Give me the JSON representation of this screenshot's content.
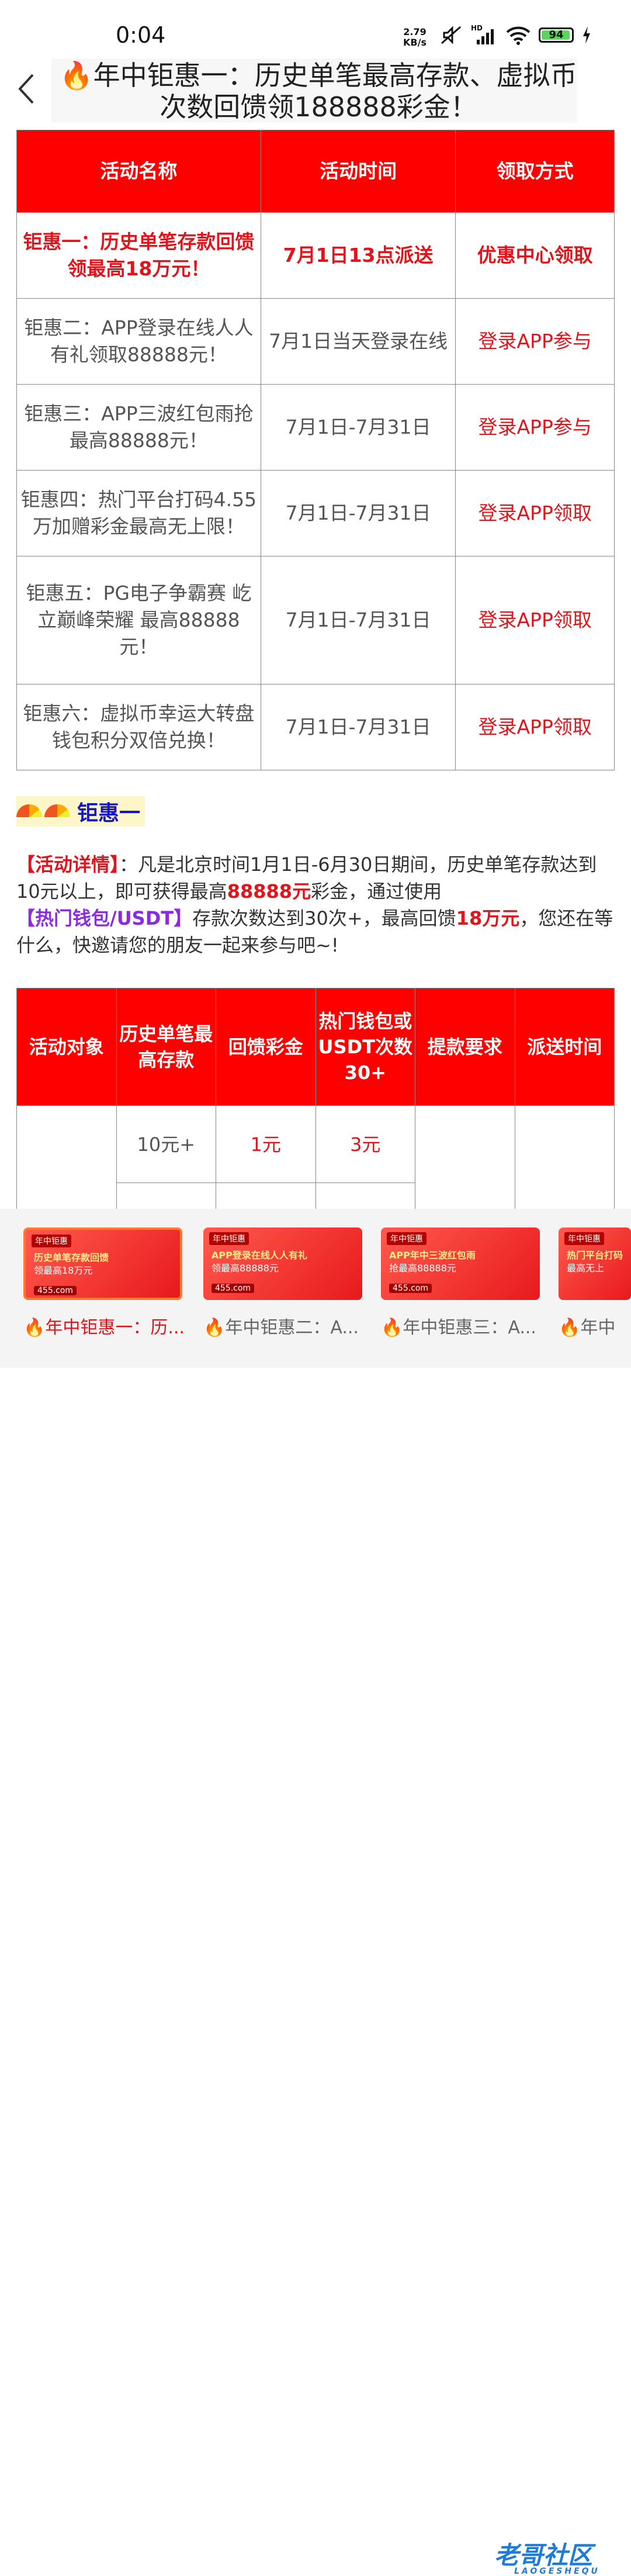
{
  "status": {
    "time": "0:04",
    "net_speed": "2.79",
    "net_unit": "KB/s",
    "battery": "94",
    "hd": "HD"
  },
  "header": {
    "title": "🔥年中钜惠一：历史单笔最高存款、虚拟币次数回馈领188888彩金！"
  },
  "table1": {
    "headers": [
      "活动名称",
      "活动时间",
      "领取方式"
    ],
    "rows": [
      {
        "name": "钜惠一：历史单笔存款回馈领最高18万元！",
        "time": "7月1日13点派送",
        "method": "优惠中心领取"
      },
      {
        "name": "钜惠二：APP登录在线人人有礼领取88888元！",
        "time": "7月1日当天登录在线",
        "method": "登录APP参与"
      },
      {
        "name": "钜惠三：APP三波红包雨抢最高88888元！",
        "time": "7月1日-7月31日",
        "method": "登录APP参与"
      },
      {
        "name": "钜惠四：热门平台打码4.55万加赠彩金最高无上限！",
        "time": "7月1日-7月31日",
        "method": "登录APP领取"
      },
      {
        "name": "钜惠五：PG电子争霸赛 屹立巅峰荣耀 最高88888元！",
        "time": "7月1日-7月31日",
        "method": "登录APP领取"
      },
      {
        "name": "钜惠六：虚拟币幸运大转盘钱包积分双倍兑换！",
        "time": "7月1日-7月31日",
        "method": "登录APP领取"
      }
    ]
  },
  "section": {
    "title": "钜惠一"
  },
  "detail": {
    "label": "【活动详情】",
    "p1": "：凡是北京时间1月1日-6月30日期间，历史单笔存款达到10元以上，即可获得最高",
    "amount": "88888元",
    "p2": "彩金，通过使用",
    "wallet": "【热门钱包/USDT】",
    "p3": "存款次数达到30次+，最高回馈",
    "max": "18万元",
    "p4": "，您还在等什么，快邀请您的朋友一起来参与吧~!"
  },
  "table2": {
    "headers": [
      "活动对象",
      "历史单笔最高存款",
      "回馈彩金",
      "热门钱包或USDT次数30+",
      "提款要求",
      "派送时间"
    ],
    "rows": [
      {
        "deposit": "10元+",
        "bonus": "1元",
        "wallet": "3元"
      }
    ]
  },
  "bottom": {
    "cards": [
      {
        "tag": "年中钜惠",
        "line1": "历史单笔存款回馈",
        "line2": "领最高18万元",
        "line3": "455.com",
        "caption": "🔥年中钜惠一：历..."
      },
      {
        "tag": "年中钜惠",
        "line1": "APP登录在线人人有礼",
        "line2": "领最高88888元",
        "line3": "455.com",
        "caption": "🔥年中钜惠二：A..."
      },
      {
        "tag": "年中钜惠",
        "line1": "APP年中三波红包雨",
        "line2": "抢最高88888元",
        "line3": "455.com",
        "caption": "🔥年中钜惠三：A..."
      },
      {
        "tag": "年中钜惠",
        "line1": "热门平台打码",
        "line2": "最高无上",
        "line3": "",
        "caption": "🔥年中"
      }
    ],
    "watermark": "老哥社区",
    "watermark_sub": "LAOGESHEQU"
  }
}
